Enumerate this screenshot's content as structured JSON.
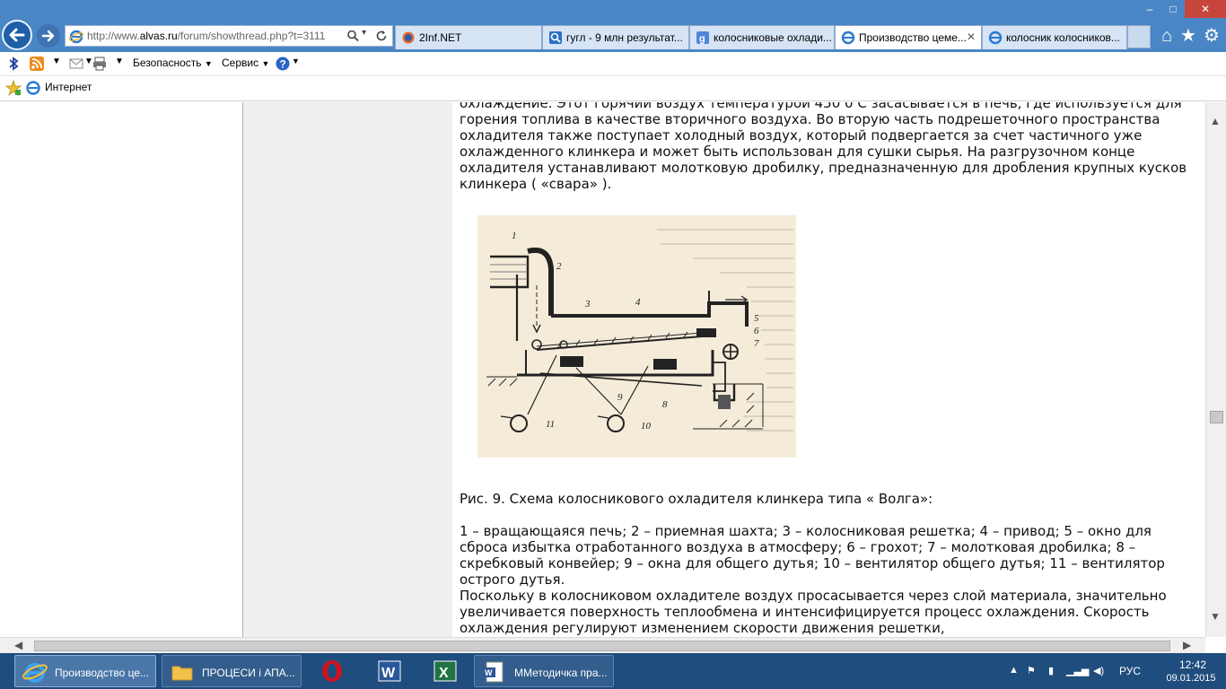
{
  "window": {
    "min_glyph": "–",
    "max_glyph": "□",
    "close_glyph": "✕"
  },
  "address": {
    "prefix": "http://www.",
    "domain": "alvas.ru",
    "path": "/forum/showthread.php?t=3111"
  },
  "tabs": [
    {
      "label": "2Inf.NET",
      "active": false
    },
    {
      "label": "гугл - 9 млн результат...",
      "active": false
    },
    {
      "label": "колосниковые охлади...",
      "active": false
    },
    {
      "label": "Производство цеме...",
      "active": true
    },
    {
      "label": "колосник колосников...",
      "active": false
    }
  ],
  "cmdbar": {
    "safety_label": "Безопасность",
    "service_label": "Сервис"
  },
  "favbar": {
    "zone_label": "Интернет"
  },
  "article": {
    "para1": "охлаждение. Этот горячий воздух температурой 450 0 С засасывается в печь, где используется для горения топлива в качестве вторичного воздуха. Во вторую часть подрешеточного пространства охладителя также поступает холодный воздух, который подвергается за счет частичного уже охлажденного клинкера и может быть использован для сушки сырья. На разгрузочном конце охладителя устанавливают молотковую дробилку, предназначенную для дробления крупных кусков клинкера ( «свара» ).",
    "caption": "Рис. 9. Схема колосникового охладителя клинкера типа « Волга»:",
    "legend": "1 – вращающаяся печь; 2 – приемная шахта; 3 – колосниковая решетка; 4 – привод; 5 – окно для сброса избытка отработанного воздуха в атмосферу; 6 – грохот; 7 – молотковая дробилка; 8 – скребковый конвейер; 9 – окна для общего дутья; 10 – вентилятор общего дутья; 11 – вентилятор острого дутья.",
    "para2": "Поскольку в колосниковом охладителе воздух просасывается через слой материала, значительно увеличивается поверхность теплообмена и интенсифицируется процесс охлаждения. Скорость охлаждения регулируют изменением скорости движения решетки,",
    "figure_numbers": [
      "1",
      "2",
      "3",
      "4",
      "5",
      "6",
      "7",
      "8",
      "9",
      "10",
      "11"
    ]
  },
  "taskbar": {
    "items": [
      {
        "label": "Производство це...",
        "icon": "ie-icon"
      },
      {
        "label": "ПРОЦЕСИ і АПА...",
        "icon": "folder-icon"
      },
      {
        "label": "",
        "icon": "opera-icon"
      },
      {
        "label": "",
        "icon": "word-icon"
      },
      {
        "label": "",
        "icon": "excel-icon"
      },
      {
        "label": "ММетодичка пра...",
        "icon": "word-doc-icon"
      }
    ],
    "lang": "РУС",
    "time": "12:42",
    "date": "09.01.2015"
  }
}
